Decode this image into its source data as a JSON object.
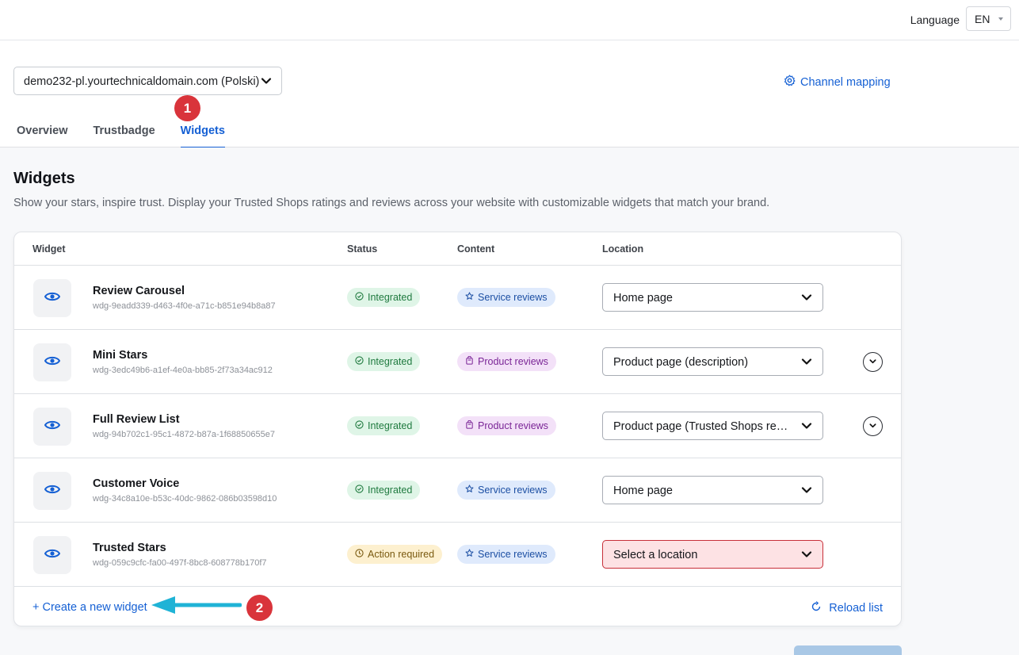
{
  "topbar": {
    "language_label": "Language",
    "language_value": "EN"
  },
  "header": {
    "channel": "demo232-pl.yourtechnicaldomain.com (Polski)",
    "channel_mapping": "Channel mapping",
    "tabs": [
      {
        "label": "Overview",
        "active": false
      },
      {
        "label": "Trustbadge",
        "active": false
      },
      {
        "label": "Widgets",
        "active": true
      }
    ]
  },
  "annotations": {
    "step1": "1",
    "step2": "2"
  },
  "main": {
    "title": "Widgets",
    "description": "Show your stars, inspire trust. Display your Trusted Shops ratings and reviews across your website with customizable widgets that match your brand."
  },
  "table": {
    "headers": {
      "widget": "Widget",
      "status": "Status",
      "content": "Content",
      "location": "Location"
    },
    "rows": [
      {
        "name": "Review Carousel",
        "id": "wdg-9eadd339-d463-4f0e-a71c-b851e94b8a87",
        "status": "Integrated",
        "content": "Service reviews",
        "location": "Home page"
      },
      {
        "name": "Mini Stars",
        "id": "wdg-3edc49b6-a1ef-4e0a-bb85-2f73a34ac912",
        "status": "Integrated",
        "content": "Product reviews",
        "location": "Product page (description)"
      },
      {
        "name": "Full Review List",
        "id": "wdg-94b702c1-95c1-4872-b87a-1f68850655e7",
        "status": "Integrated",
        "content": "Product reviews",
        "location": "Product page (Trusted Shops reviews tab)"
      },
      {
        "name": "Customer Voice",
        "id": "wdg-34c8a10e-b53c-40dc-9862-086b03598d10",
        "status": "Integrated",
        "content": "Service reviews",
        "location": "Home page"
      },
      {
        "name": "Trusted Stars",
        "id": "wdg-059c9cfc-fa00-497f-8bc8-608778b170f7",
        "status": "Action required",
        "content": "Service reviews",
        "location": "Select a location"
      }
    ],
    "create_link": "+ Create a new widget",
    "reload_link": "Reload list"
  },
  "colors": {
    "accent": "#1560d4",
    "annotation_red": "#d9343b",
    "arrow_cyan": "#1fb3d6"
  }
}
